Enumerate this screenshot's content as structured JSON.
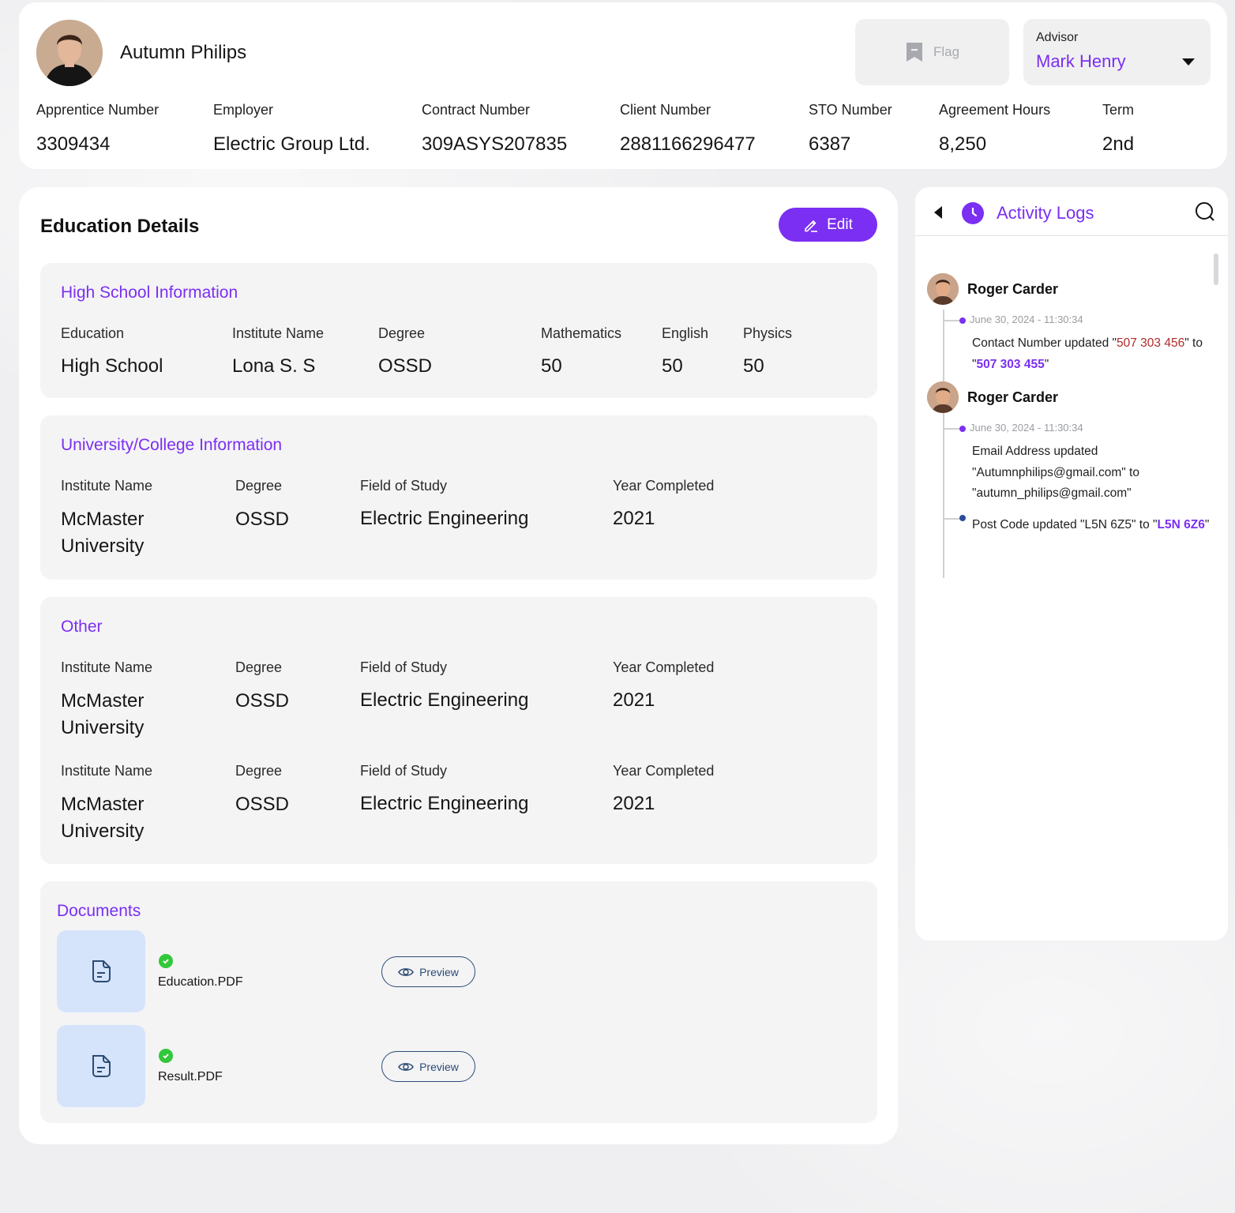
{
  "header": {
    "user_name": "Autumn Philips",
    "flag_label": "Flag",
    "advisor_label": "Advisor",
    "advisor_name": "Mark Henry",
    "fields": [
      {
        "label": "Apprentice Number",
        "value": "3309434"
      },
      {
        "label": "Employer",
        "value": "Electric Group Ltd."
      },
      {
        "label": "Contract Number",
        "value": "309ASYS207835"
      },
      {
        "label": "Client Number",
        "value": "2881166296477"
      },
      {
        "label": "STO Number",
        "value": "6387"
      },
      {
        "label": "Agreement Hours",
        "value": "8,250"
      },
      {
        "label": "Term",
        "value": "2nd"
      }
    ]
  },
  "education": {
    "title": "Education Details",
    "edit_label": "Edit",
    "high_school": {
      "title": "High School Information",
      "fields": [
        {
          "label": "Education",
          "value": "High School"
        },
        {
          "label": "Institute Name",
          "value": "Lona S. S"
        },
        {
          "label": "Degree",
          "value": "OSSD"
        },
        {
          "label": "Mathematics",
          "value": "50"
        },
        {
          "label": "English",
          "value": "50"
        },
        {
          "label": "Physics",
          "value": "50"
        }
      ]
    },
    "university": {
      "title": "University/College Information",
      "fields": [
        {
          "label": "Institute Name",
          "value": "McMaster University"
        },
        {
          "label": "Degree",
          "value": "OSSD"
        },
        {
          "label": "Field of Study",
          "value": "Electric Engineering"
        },
        {
          "label": "Year Completed",
          "value": "2021"
        }
      ]
    },
    "other": {
      "title": "Other",
      "rows": [
        [
          {
            "label": "Institute Name",
            "value": "McMaster University"
          },
          {
            "label": "Degree",
            "value": "OSSD"
          },
          {
            "label": "Field of Study",
            "value": "Electric Engineering"
          },
          {
            "label": "Year Completed",
            "value": "2021"
          }
        ],
        [
          {
            "label": "Institute Name",
            "value": "McMaster University"
          },
          {
            "label": "Degree",
            "value": "OSSD"
          },
          {
            "label": "Field of Study",
            "value": "Electric Engineering"
          },
          {
            "label": "Year Completed",
            "value": "2021"
          }
        ]
      ]
    },
    "documents": {
      "title": "Documents",
      "items": [
        {
          "name": "Education.PDF",
          "action": "Preview"
        },
        {
          "name": "Result.PDF",
          "action": "Preview"
        }
      ]
    }
  },
  "activity": {
    "title": "Activity Logs",
    "entries": [
      {
        "user": "Roger Carder",
        "date": "June 30, 2024 - 11:30:34",
        "text_1": "Contact Number updated \"",
        "old": "507 303 456",
        "text_2": "\" to \"",
        "new": "507 303 455",
        "text_3": "\""
      },
      {
        "user": "Roger Carder",
        "date": "June 30, 2024 - 11:30:34",
        "change_1": "Email Address updated \"Autumnphilips@gmail.com\" to \"autumn_philips@gmail.com\"",
        "change_2_prefix": "Post Code updated \"L5N 6Z5\" to \"",
        "change_2_new": "L5N 6Z6",
        "change_2_suffix": "\""
      }
    ]
  },
  "colors": {
    "accent": "#7b2ff2",
    "old_value": "#b32a2a",
    "document_bg": "#d5e4fb",
    "success": "#33c73a"
  },
  "icons": [
    "flag-icon",
    "dropdown-caret-icon",
    "edit-pencil-icon",
    "document-icon",
    "check-icon",
    "eye-icon",
    "back-arrow-icon",
    "clock-icon",
    "search-icon"
  ]
}
